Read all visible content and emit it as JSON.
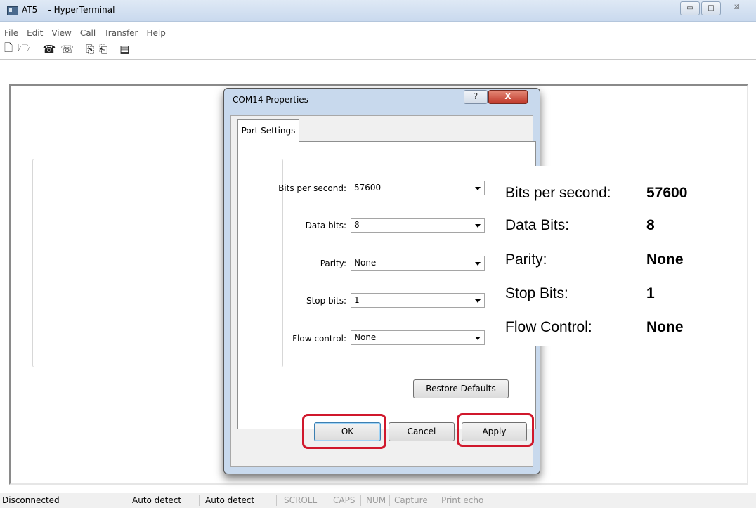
{
  "window": {
    "title": "AT5    - HyperTerminal",
    "minimize": "▭",
    "maximize": "□",
    "close": "☒"
  },
  "menu": [
    "File",
    "Edit",
    "View",
    "Call",
    "Transfer",
    "Help"
  ],
  "toolbar_icons": [
    "new-icon",
    "open-icon",
    "call-icon",
    "disconnect-icon",
    "send-icon",
    "receive-icon",
    "properties-icon"
  ],
  "dialog": {
    "title": "COM14 Properties",
    "help": "?",
    "close": "X",
    "tab": "Port Settings",
    "fields": [
      {
        "label": "Bits per second:",
        "value": "57600"
      },
      {
        "label": "Data bits:",
        "value": "8"
      },
      {
        "label": "Parity:",
        "value": "None"
      },
      {
        "label": "Stop bits:",
        "value": "1"
      },
      {
        "label": "Flow control:",
        "value": "None"
      }
    ],
    "restore_defaults": "Restore Defaults",
    "ok": "OK",
    "cancel": "Cancel",
    "apply": "Apply"
  },
  "highlight_color": "#d0182c",
  "info": [
    {
      "label": "Bits per second:",
      "value": "57600"
    },
    {
      "label": "Data Bits:",
      "value": "8"
    },
    {
      "label": "Parity:",
      "value": "None"
    },
    {
      "label": "Stop Bits:",
      "value": "1"
    },
    {
      "label": "Flow Control:",
      "value": "None"
    }
  ],
  "status": {
    "connection": "Disconnected",
    "detect1": "Auto detect",
    "detect2": "Auto detect",
    "scroll": "SCROLL",
    "caps": "CAPS",
    "num": "NUM",
    "capture": "Capture",
    "print_echo": "Print echo"
  }
}
